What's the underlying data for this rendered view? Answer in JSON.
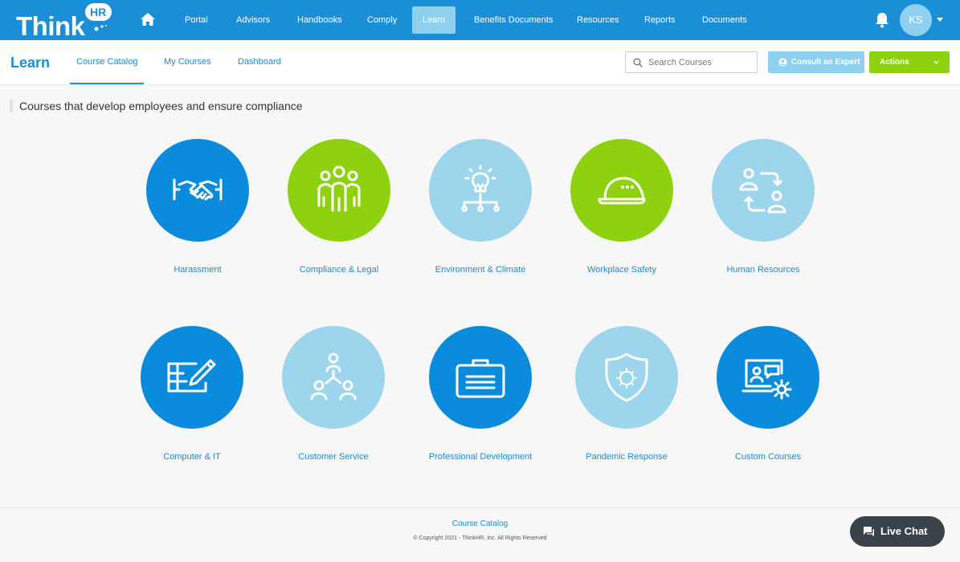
{
  "nav": {
    "logo_text": "Think",
    "logo_badge": "HR",
    "items": [
      "Portal",
      "Advisors",
      "Handbooks",
      "Comply",
      "Learn",
      "Benefits Documents",
      "Resources",
      "Reports",
      "Documents"
    ],
    "active": "Learn",
    "user_initials": "KS",
    "icons": [
      "home-icon",
      "bell-icon",
      "caret-down-icon"
    ]
  },
  "header": {
    "title": "Learn",
    "tabs": [
      "Course Catalog",
      "My Courses",
      "Dashboard"
    ],
    "active_tab": "Course Catalog",
    "search_placeholder": "Search Courses",
    "consult_label": "Consult an Expert",
    "actions_label": "Actions"
  },
  "main": {
    "section_title": "Courses that develop employees and ensure compliance",
    "categories": [
      {
        "label": "Harassment",
        "icon": "handshake-icon",
        "color": "#0a8bdc"
      },
      {
        "label": "Compliance & Legal",
        "icon": "people-group-icon",
        "color": "#8ed10f"
      },
      {
        "label": "Environment & Climate",
        "icon": "lightbulb-network-icon",
        "color": "#9dd5ec"
      },
      {
        "label": "Workplace Safety",
        "icon": "hard-hat-icon",
        "color": "#8ed10f"
      },
      {
        "label": "Human Resources",
        "icon": "people-exchange-icon",
        "color": "#9dd5ec"
      },
      {
        "label": "Computer & IT",
        "icon": "edit-form-icon",
        "color": "#0a8bdc"
      },
      {
        "label": "Customer Service",
        "icon": "org-chart-icon",
        "color": "#9dd5ec"
      },
      {
        "label": "Professional Development",
        "icon": "briefcase-icon",
        "color": "#0a8bdc"
      },
      {
        "label": "Pandemic Response",
        "icon": "virus-shield-icon",
        "color": "#9dd5ec"
      },
      {
        "label": "Custom Courses",
        "icon": "computer-gear-icon",
        "color": "#0a8bdc"
      }
    ]
  },
  "footer": {
    "link": "Course Catalog",
    "copyright": "© Copyright 2021 - ThinkHR, Inc. All Rights Reserved"
  },
  "chat": {
    "label": "Live Chat"
  },
  "colors": {
    "brand_blue": "#1a8fd8",
    "brand_green": "#8ed10f",
    "light_blue": "#9dd5ec",
    "chat_dark": "#394249"
  }
}
